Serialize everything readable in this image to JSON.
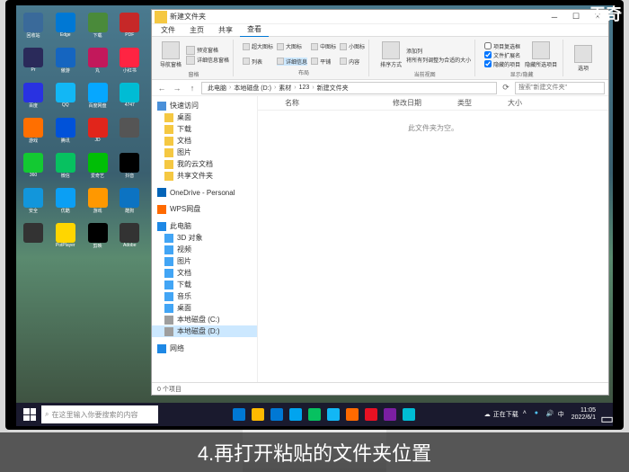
{
  "logo": "天奇",
  "caption": "4.再打开粘贴的文件夹位置",
  "desktop": {
    "icons": [
      {
        "label": "回收站",
        "color": "#3a6a9a"
      },
      {
        "label": "Edge",
        "color": "#0078d4"
      },
      {
        "label": "下载",
        "color": "#4a8a3a"
      },
      {
        "label": "PDF",
        "color": "#c62828"
      },
      {
        "label": "Pr",
        "color": "#2a2a5a"
      },
      {
        "label": "傲游",
        "color": "#1565c0"
      },
      {
        "label": "丸",
        "color": "#c2185b"
      },
      {
        "label": "小红书",
        "color": "#ff2442"
      },
      {
        "label": "百度",
        "color": "#2932e1"
      },
      {
        "label": "QQ",
        "color": "#12b7f5"
      },
      {
        "label": "百度网盘",
        "color": "#06a7ff"
      },
      {
        "label": "4747",
        "color": "#00bcd4"
      },
      {
        "label": "游戏",
        "color": "#ff6f00"
      },
      {
        "label": "腾讯",
        "color": "#0052d9"
      },
      {
        "label": "JD",
        "color": "#e1251b"
      },
      {
        "label": "",
        "color": "#555"
      },
      {
        "label": "360",
        "color": "#13c932"
      },
      {
        "label": "微信",
        "color": "#07c160"
      },
      {
        "label": "爱奇艺",
        "color": "#00be06"
      },
      {
        "label": "抖音",
        "color": "#000"
      },
      {
        "label": "安全",
        "color": "#1296db"
      },
      {
        "label": "优酷",
        "color": "#0b9ff4"
      },
      {
        "label": "游戏",
        "color": "#ff9800"
      },
      {
        "label": "酷狗",
        "color": "#0c73c2"
      },
      {
        "label": "",
        "color": "#333"
      },
      {
        "label": "PotPlayer",
        "color": "#ffd600"
      },
      {
        "label": "剪映",
        "color": "#000"
      },
      {
        "label": "Adobe",
        "color": "#333"
      }
    ]
  },
  "explorer": {
    "title": "新建文件夹",
    "tabs": {
      "file": "文件",
      "home": "主页",
      "share": "共享",
      "view": "查看"
    },
    "ribbon": {
      "panes": {
        "nav": "导航窗格",
        "preview": "预览窗格",
        "details": "详细信息窗格"
      },
      "layout": {
        "xl": "超大图标",
        "lg": "大图标",
        "md": "中图标",
        "sm": "小图标",
        "list": "列表",
        "detail": "详细信息",
        "tiles": "平铺",
        "content": "内容"
      },
      "sort": "排序方式",
      "cols": {
        "add": "添加列",
        "fit": "将所有列调整为合适的大小"
      },
      "checks": {
        "itemcb": "项目复选框",
        "ext": "文件扩展名",
        "hidden": "隐藏的项目"
      },
      "hide": "隐藏所选项目",
      "options": "选项",
      "groups": {
        "panes": "窗格",
        "layout": "布局",
        "view": "当前视图",
        "show": "显示/隐藏"
      }
    },
    "breadcrumb": [
      "此电脑",
      "本地磁盘 (D:)",
      "素材",
      "123",
      "新建文件夹"
    ],
    "search_placeholder": "搜索\"新建文件夹\"",
    "sidebar": {
      "quick": "快速访问",
      "onedrive": "OneDrive - Personal",
      "wps": "WPS网盘",
      "thispc": "此电脑",
      "thispc_items": [
        "3D 对象",
        "视频",
        "图片",
        "文档",
        "下载",
        "音乐",
        "桌面",
        "本地磁盘 (C:)",
        "本地磁盘 (D:)"
      ],
      "network": "网络",
      "quick_items": [
        "桌面",
        "下载",
        "文档",
        "图片",
        "我的云文档",
        "共享文件夹"
      ]
    },
    "columns": {
      "name": "名称",
      "date": "修改日期",
      "type": "类型",
      "size": "大小"
    },
    "empty": "此文件夹为空。",
    "status": "0 个项目"
  },
  "taskbar": {
    "search": "在这里输入你要搜索的内容",
    "weather": "正在下载",
    "time": "11:05",
    "date": "2022/6/1",
    "apps": [
      {
        "c": "#0078d4"
      },
      {
        "c": "#ffb900"
      },
      {
        "c": "#0078d4"
      },
      {
        "c": "#00a4ef"
      },
      {
        "c": "#07c160"
      },
      {
        "c": "#12b7f5"
      },
      {
        "c": "#ff6a00"
      },
      {
        "c": "#e81123"
      },
      {
        "c": "#7b1fa2"
      },
      {
        "c": "#00bcd4"
      }
    ]
  }
}
